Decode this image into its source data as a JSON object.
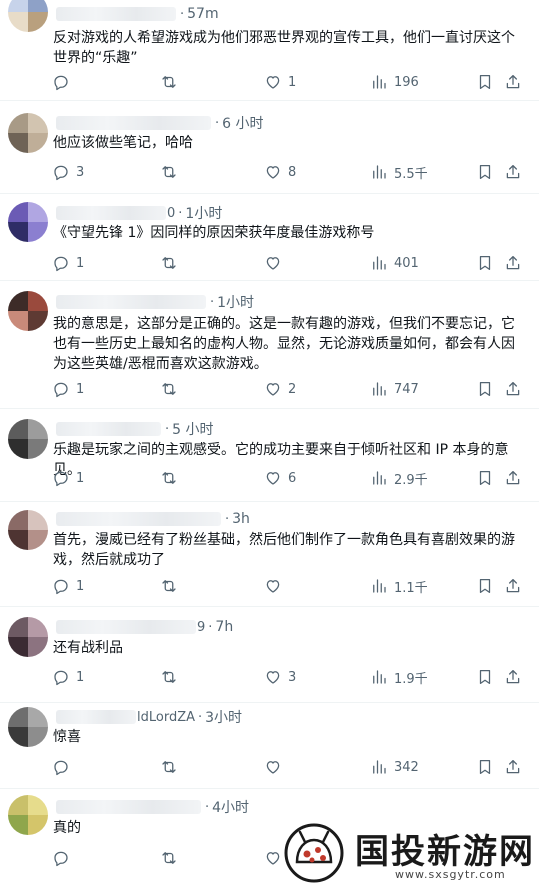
{
  "tweets": [
    {
      "handle_tail": "",
      "time": "57m",
      "text": "反对游戏的人希望游戏成为他们邪恶世界观的宣传工具，他们一直讨厌这个世界的“乐趣”",
      "reply": "",
      "retweet": "",
      "like": "1",
      "views": "196",
      "avatar_colors": [
        "#c7d3ea",
        "#8ea1c7",
        "#e8dcc8",
        "#b9a07e"
      ]
    },
    {
      "handle_tail": "",
      "time": "6 小时",
      "text": "他应该做些笔记，哈哈",
      "reply": "3",
      "retweet": "",
      "like": "8",
      "views": "5.5千",
      "avatar_colors": [
        "#a89a86",
        "#d2c4b0",
        "#6f6356",
        "#bfae98"
      ]
    },
    {
      "handle_tail": "0",
      "time": "1小时",
      "text": "《守望先锋 1》因同样的原因荣获年度最佳游戏称号",
      "reply": "1",
      "retweet": "",
      "like": "",
      "views": "401",
      "avatar_colors": [
        "#6b5bb5",
        "#b0a6e2",
        "#2f2d66",
        "#8b7fd0"
      ]
    },
    {
      "handle_tail": "",
      "time": "1小时",
      "text": "我的意思是，这部分是正确的。这是一款有趣的游戏，但我们不要忘记，它也有一些历史上最知名的虚构人物。显然，无论游戏质量如何，都会有人因为这些英雄/恶棍而喜欢这款游戏。",
      "reply": "1",
      "retweet": "",
      "like": "2",
      "views": "747",
      "avatar_colors": [
        "#3d2b28",
        "#9a4a3d",
        "#c98a7a",
        "#5e3a33"
      ]
    },
    {
      "handle_tail": "",
      "time": "5 小时",
      "text": "乐趣是玩家之间的主观感受。它的成功主要来自于倾听社区和 IP 本身的意见。",
      "reply": "1",
      "retweet": "",
      "like": "6",
      "views": "2.9千",
      "avatar_colors": [
        "#5c5c5c",
        "#9c9c9c",
        "#2e2e2e",
        "#7a7a7a"
      ]
    },
    {
      "handle_tail": "",
      "time": "3h",
      "text": "首先，漫威已经有了粉丝基础，然后他们制作了一款角色具有喜剧效果的游戏，然后就成功了",
      "reply": "1",
      "retweet": "",
      "like": "",
      "views": "1.1千",
      "avatar_colors": [
        "#8a6a66",
        "#d7c3bd",
        "#4e3432",
        "#b39089"
      ]
    },
    {
      "handle_tail": "9",
      "time": "7h",
      "text": "还有战利品",
      "reply": "1",
      "retweet": "",
      "like": "3",
      "views": "1.9千",
      "avatar_colors": [
        "#6d5a63",
        "#b59aa6",
        "#3b2b33",
        "#8c7380"
      ]
    },
    {
      "handle_tail": "ldLordZA",
      "time": "3小时",
      "text": "惊喜",
      "reply": "",
      "retweet": "",
      "like": "",
      "views": "342",
      "avatar_colors": [
        "#6e6e6e",
        "#a8a8a8",
        "#3a3a3a",
        "#8d8d8d"
      ]
    },
    {
      "handle_tail": "",
      "time": "4小时",
      "text": "真的",
      "reply": "",
      "retweet": "",
      "like": "",
      "views": "",
      "avatar_colors": [
        "#c9c06a",
        "#e6dc8c",
        "#8fa64c",
        "#d4c56a"
      ]
    }
  ],
  "watermark": {
    "title": "国投新游网",
    "subtitle": "www.sxsgytr.com"
  },
  "icons": {
    "reply": "speech-bubble",
    "retweet": "retweet-arrows",
    "like": "heart",
    "views": "bar-chart",
    "bookmark": "bookmark",
    "share": "share-arrow"
  }
}
